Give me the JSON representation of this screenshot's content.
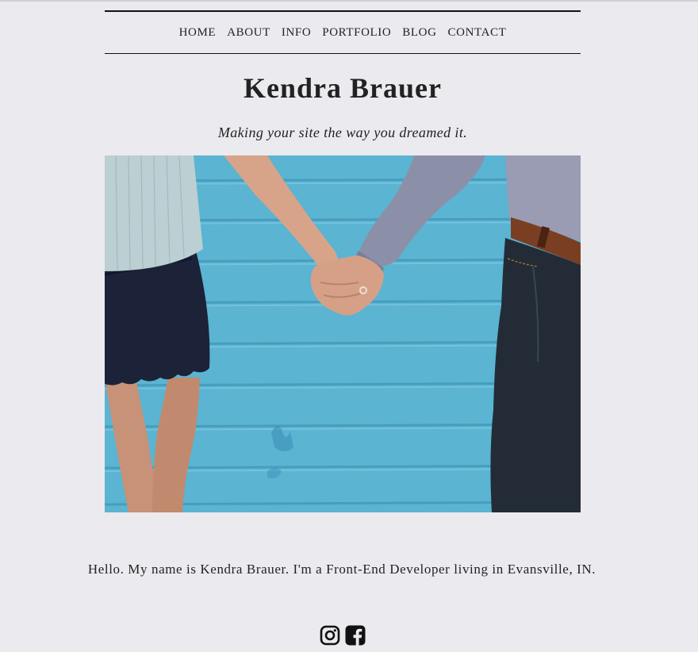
{
  "nav": {
    "items": [
      {
        "label": "HOME"
      },
      {
        "label": "ABOUT"
      },
      {
        "label": "INFO"
      },
      {
        "label": "PORTFOLIO"
      },
      {
        "label": "BLOG"
      },
      {
        "label": "CONTACT"
      }
    ]
  },
  "header": {
    "title": "Kendra Brauer",
    "tagline": "Making your site the way you dreamed it."
  },
  "hero": {
    "icon": "hero-photo-holding-hands"
  },
  "main": {
    "intro": "Hello. My name is Kendra Brauer. I'm a Front-End Developer living in Evansville, IN."
  },
  "social": {
    "icons": [
      "instagram-icon",
      "facebook-icon"
    ]
  },
  "colors": {
    "background": "#ebeaef",
    "text": "#222222",
    "wall_blue": "#5ab4d2"
  }
}
